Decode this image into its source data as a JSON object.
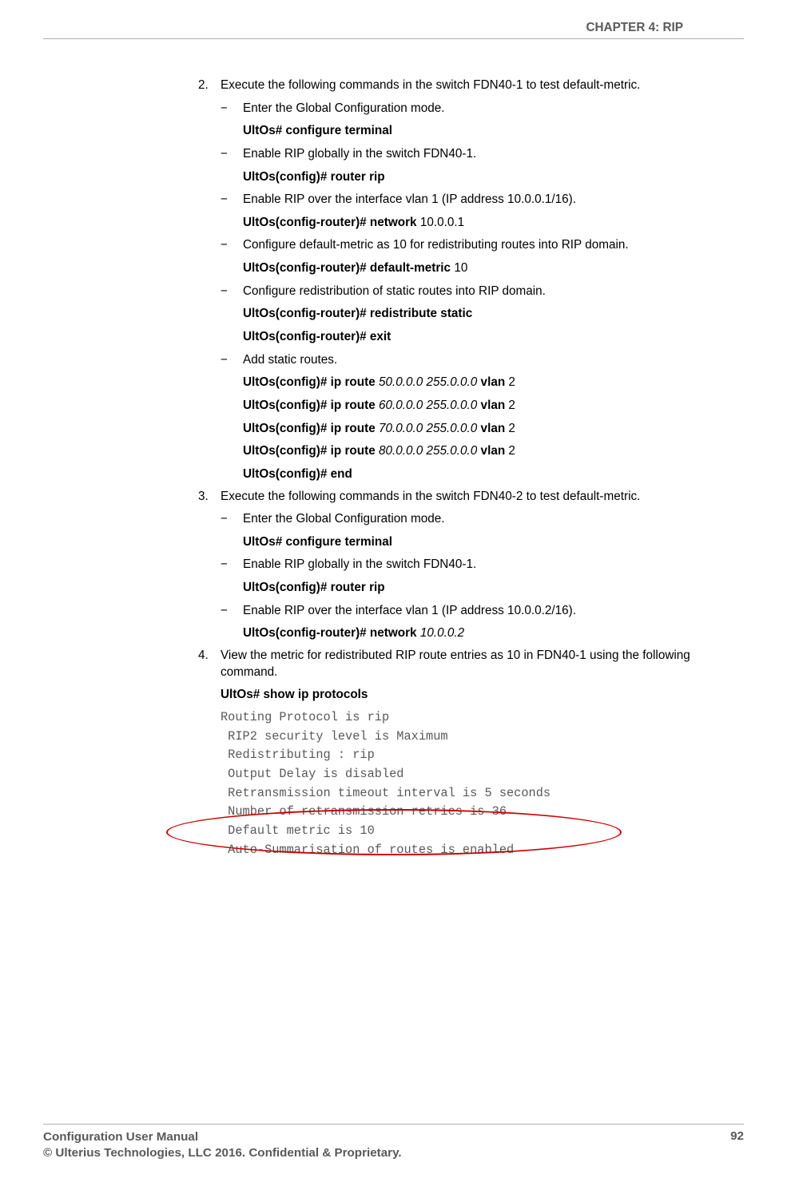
{
  "header": {
    "chapter_label": "CHAPTER 4: RIP"
  },
  "content": {
    "step2": {
      "num": "2.",
      "text": "Execute the following commands in the switch FDN40-1 to test default-metric.",
      "sub": [
        {
          "dash": "−",
          "text": "Enter the Global Configuration mode.",
          "cmds": [
            {
              "bold": "UltOs# configure terminal"
            }
          ]
        },
        {
          "dash": "−",
          "text": "Enable RIP globally in the switch FDN40-1.",
          "cmds": [
            {
              "bold": "UltOs(config)# router rip"
            }
          ]
        },
        {
          "dash": "−",
          "text": "Enable RIP over the interface vlan 1 (IP address 10.0.0.1/16).",
          "cmds": [
            {
              "bold": "UltOs(config-router)# network ",
              "light": "10.0.0.1"
            }
          ]
        },
        {
          "dash": "−",
          "text": "Configure default-metric as 10 for redistributing routes into RIP domain.",
          "cmds": [
            {
              "bold": "UltOs(config-router)# default-metric ",
              "light": "10"
            }
          ]
        },
        {
          "dash": "−",
          "text": "Configure redistribution of static routes into RIP domain.",
          "cmds": [
            {
              "bold": "UltOs(config-router)# redistribute static"
            },
            {
              "bold": "UltOs(config-router)# exit"
            }
          ]
        },
        {
          "dash": "−",
          "text": "Add static routes.",
          "cmds": [
            {
              "bold": "UltOs(config)# ip route ",
              "ital": "50.0.0.0 255.0.0.0",
              "bold2": " vlan ",
              "light": "2"
            },
            {
              "bold": "UltOs(config)# ip route ",
              "ital": "60.0.0.0 255.0.0.0",
              "bold2": " vlan ",
              "light": "2"
            },
            {
              "bold": "UltOs(config)# ip route ",
              "ital": "70.0.0.0 255.0.0.0",
              "bold2": " vlan ",
              "light": "2"
            },
            {
              "bold": "UltOs(config)# ip route ",
              "ital": "80.0.0.0 255.0.0.0",
              "bold2": " vlan ",
              "light": "2"
            },
            {
              "bold": "UltOs(config)# end"
            }
          ]
        }
      ]
    },
    "step3": {
      "num": "3.",
      "text": "Execute the following commands in the switch FDN40-2 to test default-metric.",
      "sub": [
        {
          "dash": "−",
          "text": "Enter the Global Configuration mode.",
          "cmds": [
            {
              "bold": "UltOs# configure terminal"
            }
          ]
        },
        {
          "dash": "−",
          "text": "Enable RIP globally in the switch FDN40-1.",
          "cmds": [
            {
              "bold": "UltOs(config)# router rip"
            }
          ]
        },
        {
          "dash": "−",
          "text": "Enable RIP over the interface vlan 1 (IP address 10.0.0.2/16).",
          "cmds": [
            {
              "bold": "UltOs(config-router)# network ",
              "ital": "10.0.0.2"
            }
          ]
        }
      ]
    },
    "step4": {
      "num": "4.",
      "text": "View the metric for redistributed RIP route entries as 10 in FDN40-1 using the following command.",
      "cmd": "UltOs# show ip protocols",
      "output": "Routing Protocol is rip\n RIP2 security level is Maximum\n Redistributing : rip\n Output Delay is disabled\n Retransmission timeout interval is 5 seconds\n Number of retransmission retries is 36\n Default metric is 10\n Auto-Summarisation of routes is enabled"
    }
  },
  "footer": {
    "left1": "Configuration User Manual",
    "left2": "© Ulterius Technologies, LLC 2016. Confidential & Proprietary.",
    "page": "92"
  }
}
